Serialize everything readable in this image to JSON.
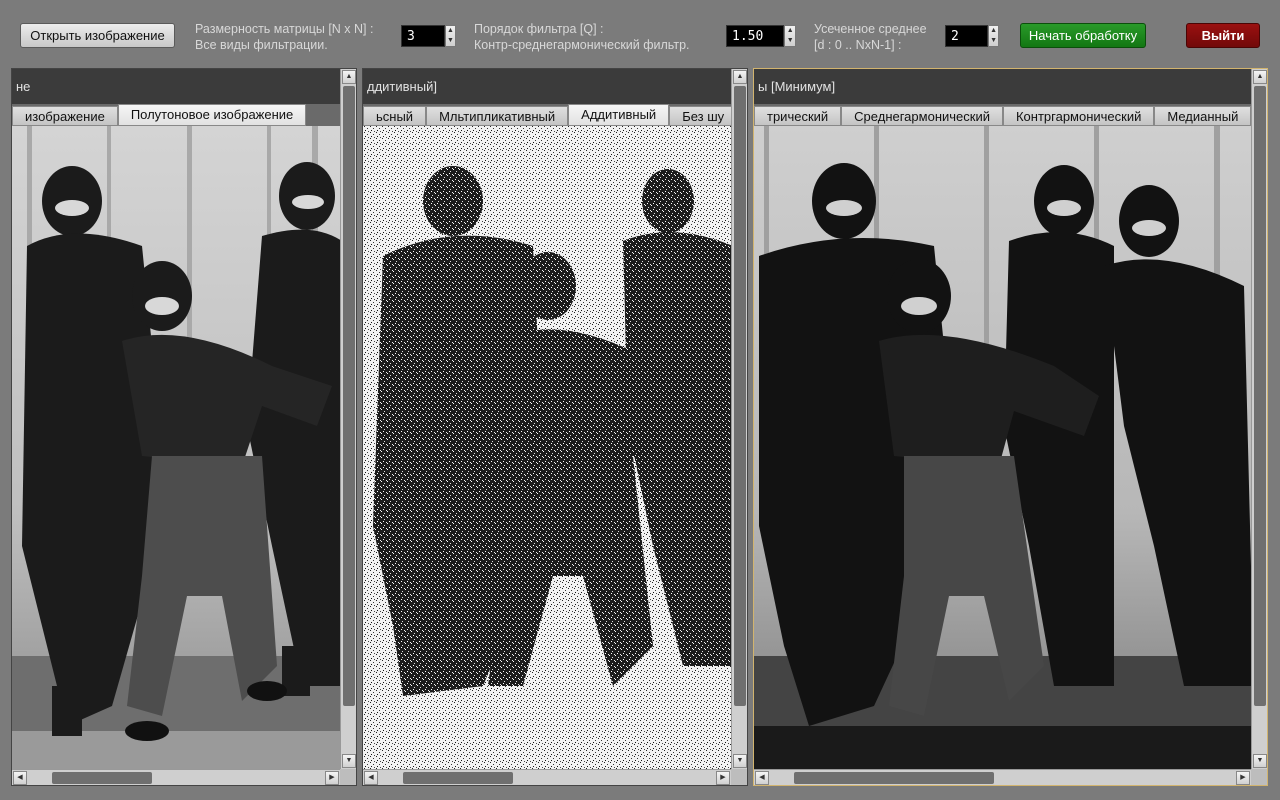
{
  "toolbar": {
    "open_button": "Открыть изображение",
    "matrix_label_1": "Размерность матрицы [N x N] :",
    "matrix_label_2": "Все виды фильтрации.",
    "matrix_value": "3",
    "order_label_1": "Порядок фильтра [Q] :",
    "order_label_2": "Контр-среднегармонический фильтр.",
    "order_value": "1.50",
    "trunc_label_1": "Усеченное среднее",
    "trunc_label_2": "[d : 0 .. NxN-1] :",
    "trunc_value": "2",
    "start_button": "Начать обработку",
    "exit_button": "Выйти"
  },
  "panels": [
    {
      "title": "не",
      "tabs": [
        "изображение",
        "Полутоновое изображение"
      ],
      "selected": 1
    },
    {
      "title": "ддитивный]",
      "tabs": [
        "ьсный",
        "Мльтипликативный",
        "Аддитивный",
        "Без шу"
      ],
      "selected": 2
    },
    {
      "title": "ы [Минимум]",
      "tabs": [
        "трический",
        "Среднегармонический",
        "Контргармонический",
        "Медианный"
      ],
      "selected": -1
    }
  ],
  "colors": {
    "background": "#7b7b7b",
    "start_button": "#1a8a1a",
    "exit_button": "#820c0c",
    "active_border": "#d2b46e"
  }
}
